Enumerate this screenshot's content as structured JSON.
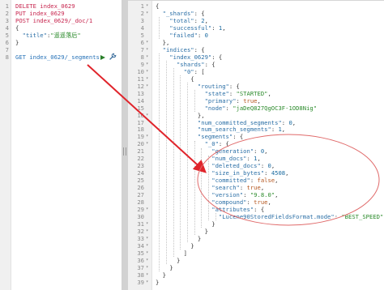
{
  "request_editor": {
    "lines": [
      {
        "n": "1",
        "parts": [
          {
            "t": "DELETE index_0629",
            "c": "m"
          }
        ]
      },
      {
        "n": "2",
        "parts": [
          {
            "t": "PUT index_0629",
            "c": "m"
          }
        ]
      },
      {
        "n": "3",
        "parts": [
          {
            "t": "POST index_0629/_doc/1",
            "c": "m"
          }
        ]
      },
      {
        "n": "4",
        "parts": [
          {
            "t": "{",
            "c": "p"
          }
        ]
      },
      {
        "n": "5",
        "parts": [
          {
            "t": "  \"title\"",
            "c": "k"
          },
          {
            "t": ":",
            "c": "p"
          },
          {
            "t": "\"遥遥落后\"",
            "c": "s"
          }
        ]
      },
      {
        "n": "6",
        "parts": [
          {
            "t": "}",
            "c": "p"
          }
        ]
      },
      {
        "n": "7",
        "parts": []
      },
      {
        "n": "8",
        "parts": [
          {
            "t": "GET index_0629/_segments",
            "c": "u"
          }
        ]
      }
    ]
  },
  "actions": {
    "run_icon": "play-icon",
    "settings_icon": "wrench-icon",
    "divider_icon": "vertical-grip-icon"
  },
  "response_editor": {
    "lines": [
      {
        "n": "1",
        "fold": true,
        "parts": [
          {
            "t": "{",
            "c": "p"
          }
        ]
      },
      {
        "n": "2",
        "fold": true,
        "parts": [
          {
            "t": "  \"_shards\"",
            "c": "k"
          },
          {
            "t": ": {",
            "c": "p"
          }
        ]
      },
      {
        "n": "3",
        "parts": [
          {
            "t": "    \"total\"",
            "c": "k"
          },
          {
            "t": ": ",
            "c": "p"
          },
          {
            "t": "2",
            "c": "n"
          },
          {
            "t": ",",
            "c": "p"
          }
        ]
      },
      {
        "n": "4",
        "parts": [
          {
            "t": "    \"successful\"",
            "c": "k"
          },
          {
            "t": ": ",
            "c": "p"
          },
          {
            "t": "1",
            "c": "n"
          },
          {
            "t": ",",
            "c": "p"
          }
        ]
      },
      {
        "n": "5",
        "parts": [
          {
            "t": "    \"failed\"",
            "c": "k"
          },
          {
            "t": ": ",
            "c": "p"
          },
          {
            "t": "0",
            "c": "n"
          }
        ]
      },
      {
        "n": "6",
        "fold": true,
        "parts": [
          {
            "t": "  },",
            "c": "p"
          }
        ]
      },
      {
        "n": "7",
        "fold": true,
        "parts": [
          {
            "t": "  \"indices\"",
            "c": "k"
          },
          {
            "t": ": {",
            "c": "p"
          }
        ]
      },
      {
        "n": "8",
        "fold": true,
        "parts": [
          {
            "t": "    \"index_0629\"",
            "c": "k"
          },
          {
            "t": ": {",
            "c": "p"
          }
        ]
      },
      {
        "n": "9",
        "fold": true,
        "parts": [
          {
            "t": "      \"shards\"",
            "c": "k"
          },
          {
            "t": ": {",
            "c": "p"
          }
        ]
      },
      {
        "n": "10",
        "fold": true,
        "parts": [
          {
            "t": "        \"0\"",
            "c": "k"
          },
          {
            "t": ": [",
            "c": "p"
          }
        ]
      },
      {
        "n": "11",
        "fold": true,
        "parts": [
          {
            "t": "          {",
            "c": "p"
          }
        ]
      },
      {
        "n": "12",
        "fold": true,
        "parts": [
          {
            "t": "            \"routing\"",
            "c": "k"
          },
          {
            "t": ": {",
            "c": "p"
          }
        ]
      },
      {
        "n": "13",
        "parts": [
          {
            "t": "              \"state\"",
            "c": "k"
          },
          {
            "t": ": ",
            "c": "p"
          },
          {
            "t": "\"STARTED\"",
            "c": "s"
          },
          {
            "t": ",",
            "c": "p"
          }
        ]
      },
      {
        "n": "14",
        "parts": [
          {
            "t": "              \"primary\"",
            "c": "k"
          },
          {
            "t": ": ",
            "c": "p"
          },
          {
            "t": "true",
            "c": "b"
          },
          {
            "t": ",",
            "c": "p"
          }
        ]
      },
      {
        "n": "15",
        "parts": [
          {
            "t": "              \"node\"",
            "c": "k"
          },
          {
            "t": ": ",
            "c": "p"
          },
          {
            "t": "\"jaDeQ827QgOC3F-1OD8Nig\"",
            "c": "s"
          }
        ]
      },
      {
        "n": "16",
        "fold": true,
        "parts": [
          {
            "t": "            },",
            "c": "p"
          }
        ]
      },
      {
        "n": "17",
        "parts": [
          {
            "t": "            \"num_committed_segments\"",
            "c": "k"
          },
          {
            "t": ": ",
            "c": "p"
          },
          {
            "t": "0",
            "c": "n"
          },
          {
            "t": ",",
            "c": "p"
          }
        ]
      },
      {
        "n": "18",
        "parts": [
          {
            "t": "            \"num_search_segments\"",
            "c": "k"
          },
          {
            "t": ": ",
            "c": "p"
          },
          {
            "t": "1",
            "c": "n"
          },
          {
            "t": ",",
            "c": "p"
          }
        ]
      },
      {
        "n": "19",
        "fold": true,
        "parts": [
          {
            "t": "            \"segments\"",
            "c": "k"
          },
          {
            "t": ": {",
            "c": "p"
          }
        ]
      },
      {
        "n": "20",
        "fold": true,
        "parts": [
          {
            "t": "              \"_0\"",
            "c": "k"
          },
          {
            "t": ": {",
            "c": "p"
          }
        ]
      },
      {
        "n": "21",
        "parts": [
          {
            "t": "                \"generation\"",
            "c": "k"
          },
          {
            "t": ": ",
            "c": "p"
          },
          {
            "t": "0",
            "c": "n"
          },
          {
            "t": ",",
            "c": "p"
          }
        ]
      },
      {
        "n": "22",
        "parts": [
          {
            "t": "                \"num_docs\"",
            "c": "k"
          },
          {
            "t": ": ",
            "c": "p"
          },
          {
            "t": "1",
            "c": "n"
          },
          {
            "t": ",",
            "c": "p"
          }
        ]
      },
      {
        "n": "23",
        "parts": [
          {
            "t": "                \"deleted_docs\"",
            "c": "k"
          },
          {
            "t": ": ",
            "c": "p"
          },
          {
            "t": "0",
            "c": "n"
          },
          {
            "t": ",",
            "c": "p"
          }
        ]
      },
      {
        "n": "24",
        "parts": [
          {
            "t": "                \"size_in_bytes\"",
            "c": "k"
          },
          {
            "t": ": ",
            "c": "p"
          },
          {
            "t": "4508",
            "c": "n"
          },
          {
            "t": ",",
            "c": "p"
          }
        ]
      },
      {
        "n": "25",
        "parts": [
          {
            "t": "                \"committed\"",
            "c": "k"
          },
          {
            "t": ": ",
            "c": "p"
          },
          {
            "t": "false",
            "c": "b"
          },
          {
            "t": ",",
            "c": "p"
          }
        ]
      },
      {
        "n": "26",
        "parts": [
          {
            "t": "                \"search\"",
            "c": "k"
          },
          {
            "t": ": ",
            "c": "p"
          },
          {
            "t": "true",
            "c": "b"
          },
          {
            "t": ",",
            "c": "p"
          }
        ]
      },
      {
        "n": "27",
        "parts": [
          {
            "t": "                \"version\"",
            "c": "k"
          },
          {
            "t": ": ",
            "c": "p"
          },
          {
            "t": "\"9.8.0\"",
            "c": "s"
          },
          {
            "t": ",",
            "c": "p"
          }
        ]
      },
      {
        "n": "28",
        "parts": [
          {
            "t": "                \"compound\"",
            "c": "k"
          },
          {
            "t": ": ",
            "c": "p"
          },
          {
            "t": "true",
            "c": "b"
          },
          {
            "t": ",",
            "c": "p"
          }
        ]
      },
      {
        "n": "29",
        "fold": true,
        "parts": [
          {
            "t": "                \"attributes\"",
            "c": "k"
          },
          {
            "t": ": {",
            "c": "p"
          }
        ]
      },
      {
        "n": "30",
        "parts": [
          {
            "t": "                  \"Lucene90StoredFieldsFormat.mode\"",
            "c": "k"
          },
          {
            "t": ": ",
            "c": "p"
          },
          {
            "t": "\"BEST_SPEED\"",
            "c": "s"
          }
        ]
      },
      {
        "n": "31",
        "fold": true,
        "parts": [
          {
            "t": "                }",
            "c": "p"
          }
        ]
      },
      {
        "n": "32",
        "fold": true,
        "parts": [
          {
            "t": "              }",
            "c": "p"
          }
        ]
      },
      {
        "n": "33",
        "fold": true,
        "parts": [
          {
            "t": "            }",
            "c": "p"
          }
        ]
      },
      {
        "n": "34",
        "fold": true,
        "parts": [
          {
            "t": "          }",
            "c": "p"
          }
        ]
      },
      {
        "n": "35",
        "fold": true,
        "parts": [
          {
            "t": "        ]",
            "c": "p"
          }
        ]
      },
      {
        "n": "36",
        "fold": true,
        "parts": [
          {
            "t": "      }",
            "c": "p"
          }
        ]
      },
      {
        "n": "37",
        "fold": true,
        "parts": [
          {
            "t": "    }",
            "c": "p"
          }
        ]
      },
      {
        "n": "38",
        "fold": true,
        "parts": [
          {
            "t": "  }",
            "c": "p"
          }
        ]
      },
      {
        "n": "39",
        "fold": true,
        "parts": [
          {
            "t": "}",
            "c": "p"
          }
        ]
      }
    ]
  },
  "annotation": {
    "arrow_color": "#e0242b",
    "ellipse_color": "#e06a6a"
  },
  "colors": {
    "method": "#c7254e",
    "url": "#2873b8",
    "key": "#2b6fa6",
    "string": "#2a8a2a",
    "number": "#1a6aa0",
    "boolean": "#b5571f",
    "run_button": "#2a7f2a"
  }
}
